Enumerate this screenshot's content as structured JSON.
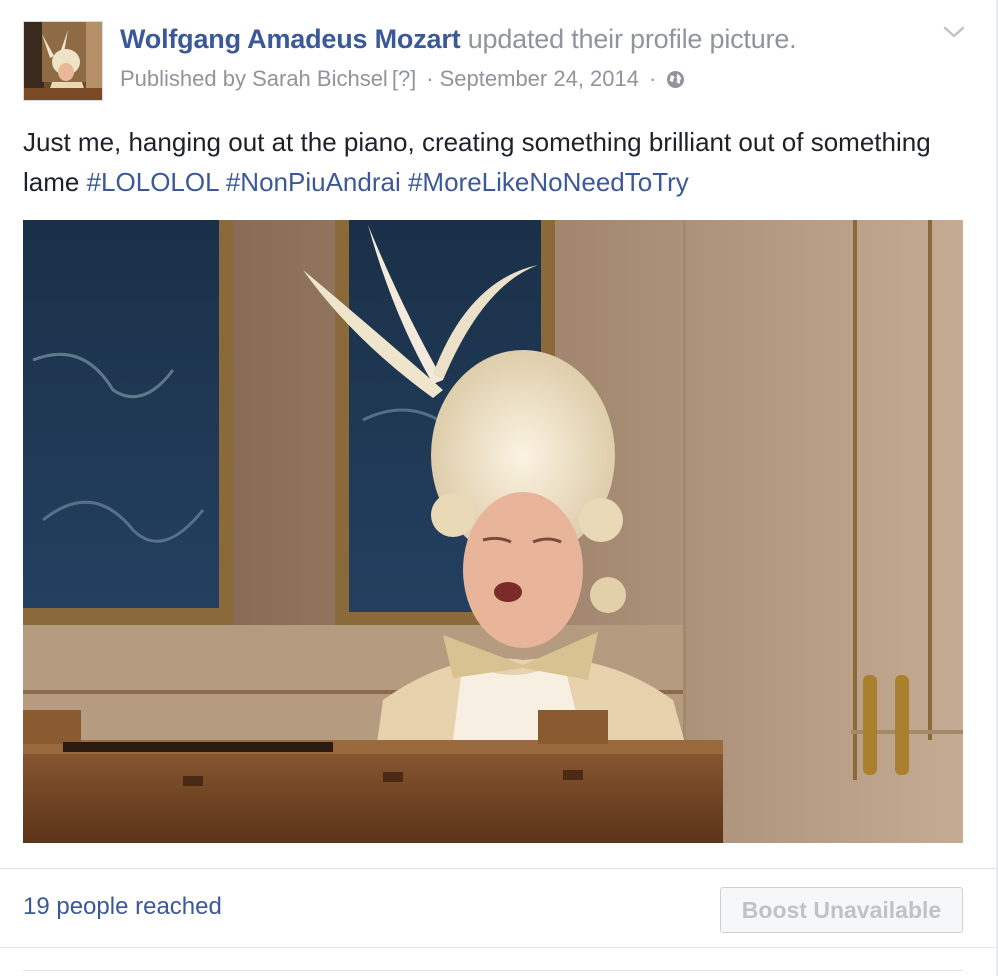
{
  "post": {
    "author": "Wolfgang Amadeus Mozart",
    "action": "updated their profile picture.",
    "published_by": "Published by Sarah Bichsel",
    "help_marker": "[?]",
    "separator": "·",
    "date": "September 24, 2014",
    "privacy_icon": "globe-icon",
    "menu_icon": "chevron-down-icon",
    "text_plain": "Just me, hanging out at the piano, creating something brilliant out of something lame",
    "hashtags": [
      "#LOLOLOL",
      "#NonPiuAndrai",
      "#MoreLikeNoNeedToTry"
    ]
  },
  "footer": {
    "reach": "19 people reached",
    "boost_label": "Boost Unavailable"
  },
  "colors": {
    "link": "#3b5998",
    "muted": "#90949c",
    "text": "#1d2129",
    "button_disabled_text": "#bec3c9"
  }
}
